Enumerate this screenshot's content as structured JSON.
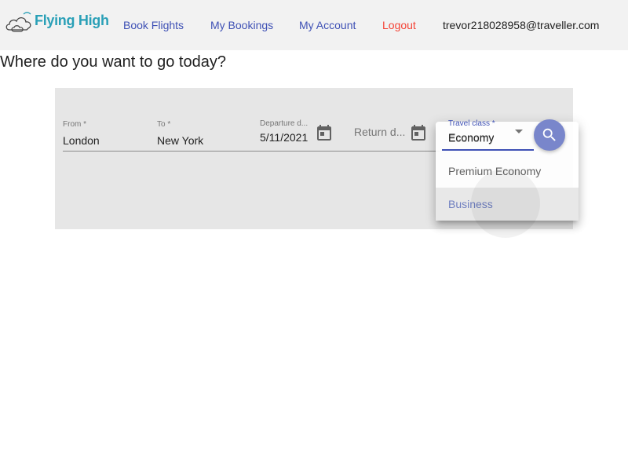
{
  "header": {
    "logo_text": "Flying High",
    "nav": {
      "book_flights": "Book Flights",
      "my_bookings": "My Bookings",
      "my_account": "My Account",
      "logout": "Logout"
    },
    "user_email": "trevor218028958@traveller.com"
  },
  "main": {
    "heading": "Where do you want to go today?"
  },
  "search": {
    "from": {
      "label": "From *",
      "value": "London"
    },
    "to": {
      "label": "To *",
      "value": "New York"
    },
    "departure": {
      "label": "Departure d...",
      "value": "5/11/2021"
    },
    "return": {
      "placeholder": "Return d..."
    },
    "travel_class": {
      "label": "Travel class *",
      "value": "Economy"
    }
  },
  "class_menu": {
    "options": [
      "Economy",
      "Premium Economy",
      "Business"
    ],
    "highlighted": "Business"
  },
  "colors": {
    "header_bg": "#f2f2f2",
    "nav_link": "#3f51b5",
    "logout": "#f44336",
    "logo": "#2aa0b7",
    "panel_bg": "#e6e6e6",
    "search_button": "#7986cb"
  },
  "icons": {
    "calendar": "calendar-icon",
    "search": "search-icon",
    "dropdown": "dropdown-arrow-icon",
    "logo": "cloud-logo-icon"
  }
}
